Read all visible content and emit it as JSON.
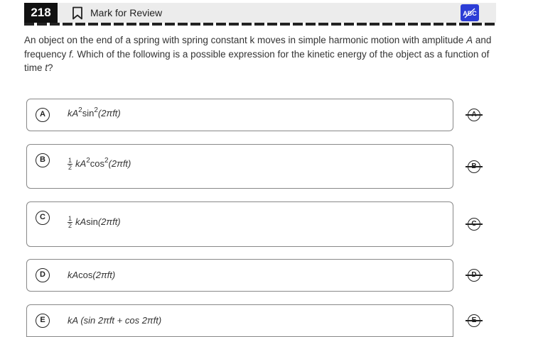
{
  "header": {
    "question_number": "218",
    "mark_label": "Mark for Review",
    "abc_button_label": "ABC",
    "accent_color": "#2c3dd6"
  },
  "question": {
    "part1": "An object on the end of a spring with spring constant k moves in simple harmonic motion with amplitude ",
    "var_A": "A",
    "part2": " and frequency ",
    "var_f": "f.",
    "part3": " Which of the following is a possible expression for the kinetic energy of the object as a function of time ",
    "var_t": "t",
    "part4": "?"
  },
  "choices": [
    {
      "letter": "A",
      "kA": "kA",
      "sq1": "2",
      "fn": "sin",
      "sq2": "2",
      "arg": "(2πft)"
    },
    {
      "letter": "B",
      "num": "1",
      "den": "2",
      "kA": "kA",
      "sq1": "2",
      "fn": "cos",
      "sq2": "2",
      "arg": "(2πft)"
    },
    {
      "letter": "C",
      "num": "1",
      "den": "2",
      "kA": "kA",
      "fn": "sin",
      "arg": "(2πft)"
    },
    {
      "letter": "D",
      "kA": "kA",
      "fn": "cos",
      "arg": "(2πft)"
    },
    {
      "letter": "E",
      "kA": "kA",
      "rest": " (sin 2πft + cos 2πft)"
    }
  ]
}
